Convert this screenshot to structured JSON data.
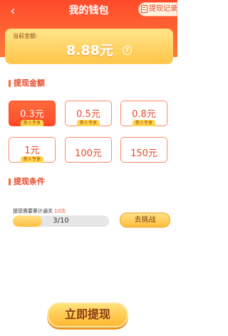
{
  "header": {
    "title": "我的钱包",
    "record_label": "提现记录",
    "back_icon": "back-chevron-icon"
  },
  "balance": {
    "label": "当前金额:",
    "value": "8.88元"
  },
  "withdraw_amount": {
    "section_title": "提现金额",
    "options": [
      {
        "label": "0.3元",
        "tag": "新人专享",
        "selected": true
      },
      {
        "label": "0.5元",
        "tag": "新人专享",
        "selected": false
      },
      {
        "label": "0.8元",
        "tag": "新人专享",
        "selected": false
      },
      {
        "label": "1元",
        "tag": "新人专享",
        "selected": false
      },
      {
        "label": "100元",
        "tag": "",
        "selected": false
      },
      {
        "label": "150元",
        "tag": "",
        "selected": false
      }
    ]
  },
  "condition": {
    "section_title": "提现条件",
    "requirement_prefix": "提现需要累计通关",
    "requirement_count": "10次",
    "progress_text": "3/10",
    "progress_fraction": 0.3,
    "challenge_label": "去挑战"
  },
  "withdraw_button": "立即提现",
  "colors": {
    "header_red": "#ff4a2a",
    "accent_orange": "#ff6a3a",
    "gold": "#ffc54a"
  }
}
